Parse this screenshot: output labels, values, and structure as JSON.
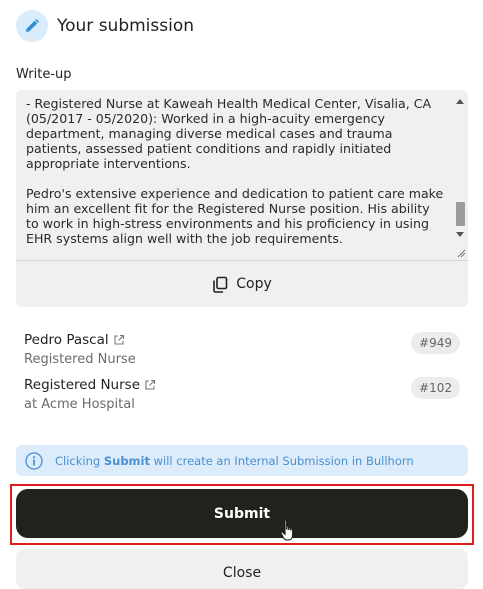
{
  "header": {
    "title": "Your submission",
    "icon": "pencil-icon"
  },
  "writeup": {
    "label": "Write-up",
    "text": "records.\n- Registered Nurse at Kaweah Health Medical Center, Visalia, CA (05/2017 - 05/2020): Worked in a high-acuity emergency department, managing diverse medical cases and trauma patients, assessed patient conditions and rapidly initiated appropriate interventions.\n\nPedro's extensive experience and dedication to patient care make him an excellent fit for the Registered Nurse position. His ability to work in high-stress environments and his proficiency in using EHR systems align well with the job requirements.",
    "copy_label": "Copy"
  },
  "candidate": {
    "name": "Pedro Pascal",
    "subtitle": "Registered Nurse",
    "id": "#949"
  },
  "job": {
    "name": "Registered Nurse",
    "subtitle": "at Acme Hospital",
    "id": "#102"
  },
  "info": {
    "prefix": "Clicking ",
    "bold": "Submit",
    "suffix": " will create an Internal Submission in Bullhorn"
  },
  "actions": {
    "submit_label": "Submit",
    "close_label": "Close"
  },
  "colors": {
    "primary": "#23211c",
    "info_bg": "#dcecfb",
    "info_text": "#4a8fd0",
    "highlight": "#e01b1b"
  }
}
